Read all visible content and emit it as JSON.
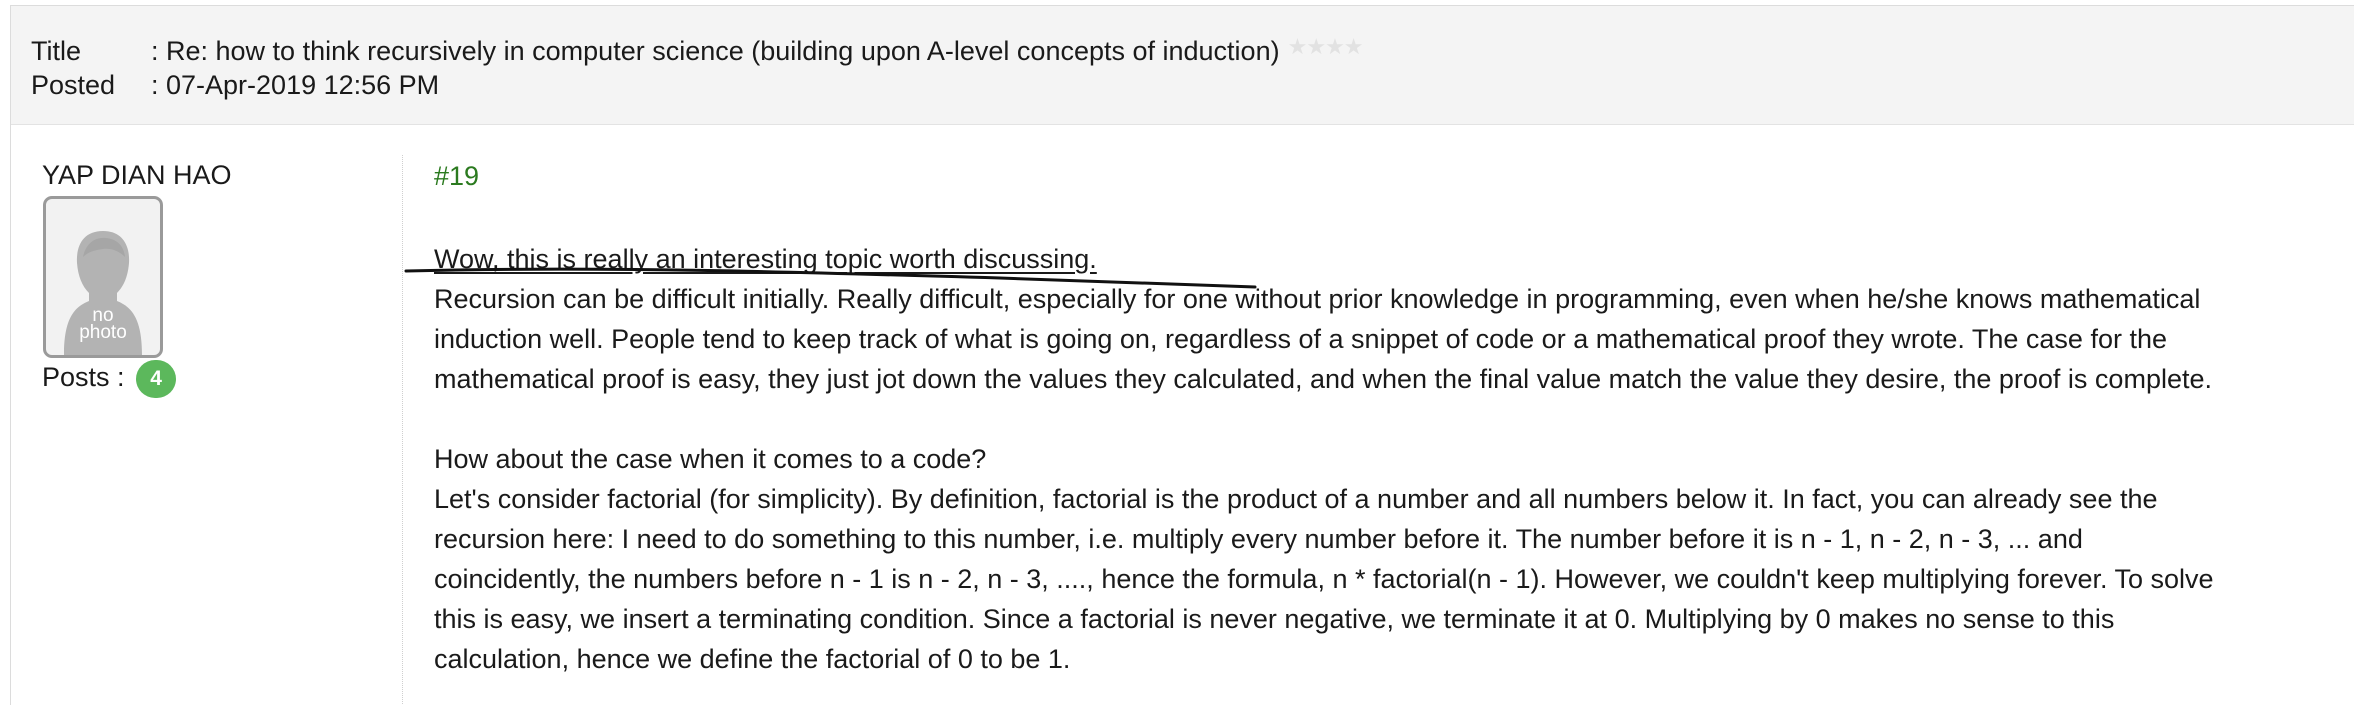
{
  "header": {
    "title_key": "Title",
    "title_value": ": Re: how to think recursively in computer science (building upon A-level concepts of induction)",
    "posted_key": "Posted",
    "posted_value": ": 07-Apr-2019 12:56 PM",
    "rating": {
      "filled": 0,
      "max": 4,
      "icon": "star-icon"
    }
  },
  "author": {
    "name": "YAP DIAN HAO",
    "avatar_text_1": "no",
    "avatar_text_2": "photo",
    "posts_label": "Posts :",
    "posts_count": "4"
  },
  "post": {
    "number": "#19",
    "lines": [
      "Wow, this is really an interesting topic worth discussing.",
      "Recursion can be difficult initially. Really difficult, especially for one without prior knowledge in programming, even when he/she knows mathematical",
      "induction well. People tend to keep track of what is going on, regardless of a snippet of code or a mathematical proof they wrote. The case for the",
      "mathematical proof is easy, they just jot down the values they calculated, and when the final value match the value they desire, the proof is complete.",
      "How about the case when it comes to a code?",
      "Let's consider factorial (for simplicity). By definition, factorial is the product of a number and all numbers below it. In fact, you can already see the",
      "recursion here: I need to do something to this number, i.e. multiply every number before it. The number before it is n - 1, n - 2, n - 3, ... and",
      "coincidently, the numbers before n - 1 is n - 2, n - 3, ...., hence the formula, n * factorial(n - 1). However, we couldn't keep multiplying forever. To solve",
      "this is easy, we insert a terminating condition. Since a factorial is never negative, we terminate it at 0. Multiplying by 0 makes no sense to this",
      "calculation, hence we define the factorial of 0 to be 1."
    ]
  }
}
